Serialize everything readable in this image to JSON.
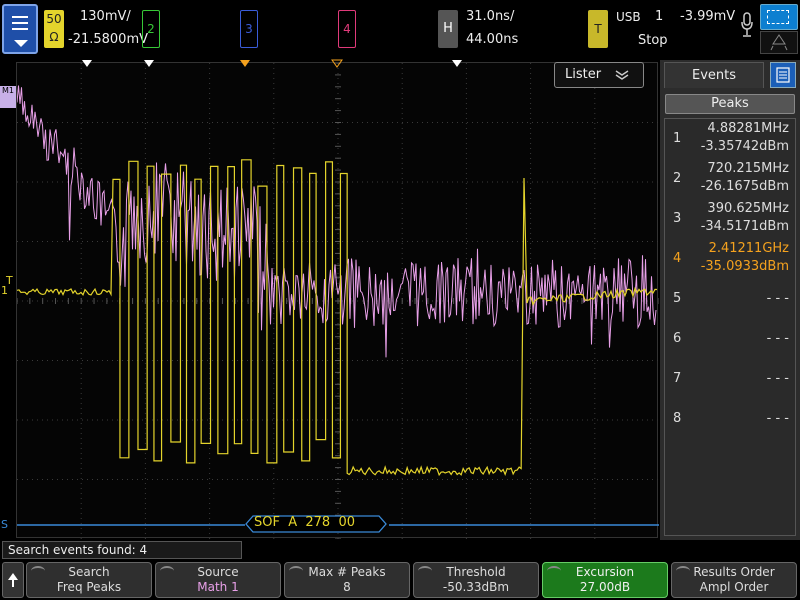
{
  "colors": {
    "ch1": "#e4d42c",
    "ch2": "#37c837",
    "ch3": "#3a5cd8",
    "ch4": "#e03a7a",
    "math": "#e8a0e8",
    "serial": "#3a8ad8",
    "highlight": "#f5a21e",
    "active_softkey": "#1c7a1c"
  },
  "header": {
    "ch1": {
      "impedance": "50\nΩ",
      "scale": "130mV/",
      "offset": "-21.5800mV"
    },
    "ch2_label": "2",
    "ch3_label": "3",
    "ch4_label": "4",
    "horizontal": {
      "label": "H",
      "scale": "31.0ns/",
      "delay": "44.00ns"
    },
    "trigger": {
      "label": "T",
      "source": "USB",
      "channel": "1",
      "level": "-3.99mV",
      "mode": "Stop"
    }
  },
  "screen": {
    "lister_label": "Lister",
    "math_marker": "M1",
    "ch1_marker": "1",
    "trig_marker": "T",
    "serial_marker": "S",
    "serial_decode": "SOF  A  278  00"
  },
  "events_panel": {
    "tab_label": "Events",
    "mode_label": "Peaks",
    "rows": [
      {
        "index": "1",
        "freq": "4.88281MHz",
        "ampl": "-3.35742dBm",
        "highlight": false
      },
      {
        "index": "2",
        "freq": "720.215MHz",
        "ampl": "-26.1675dBm",
        "highlight": false
      },
      {
        "index": "3",
        "freq": "390.625MHz",
        "ampl": "-34.5171dBm",
        "highlight": false
      },
      {
        "index": "4",
        "freq": "2.41211GHz",
        "ampl": "-35.0933dBm",
        "highlight": true
      },
      {
        "index": "5",
        "freq": "",
        "ampl": "- - -",
        "highlight": false
      },
      {
        "index": "6",
        "freq": "",
        "ampl": "- - -",
        "highlight": false
      },
      {
        "index": "7",
        "freq": "",
        "ampl": "- - -",
        "highlight": false
      },
      {
        "index": "8",
        "freq": "",
        "ampl": "- - -",
        "highlight": false
      }
    ]
  },
  "status": {
    "text": "Search events found: 4"
  },
  "softkeys": [
    {
      "title": "Search",
      "value": "Freq Peaks",
      "value_color": "#dddddd"
    },
    {
      "title": "Source",
      "value": "Math 1",
      "value_color": "#e8a0e8"
    },
    {
      "title": "Max # Peaks",
      "value": "8",
      "value_color": "#dddddd"
    },
    {
      "title": "Threshold",
      "value": "-50.33dBm",
      "value_color": "#dddddd"
    },
    {
      "title": "Excursion",
      "value": "27.00dB",
      "value_color": "#f0f0f0"
    },
    {
      "title": "Results Order",
      "value": "Ampl Order",
      "value_color": "#dddddd"
    }
  ]
}
